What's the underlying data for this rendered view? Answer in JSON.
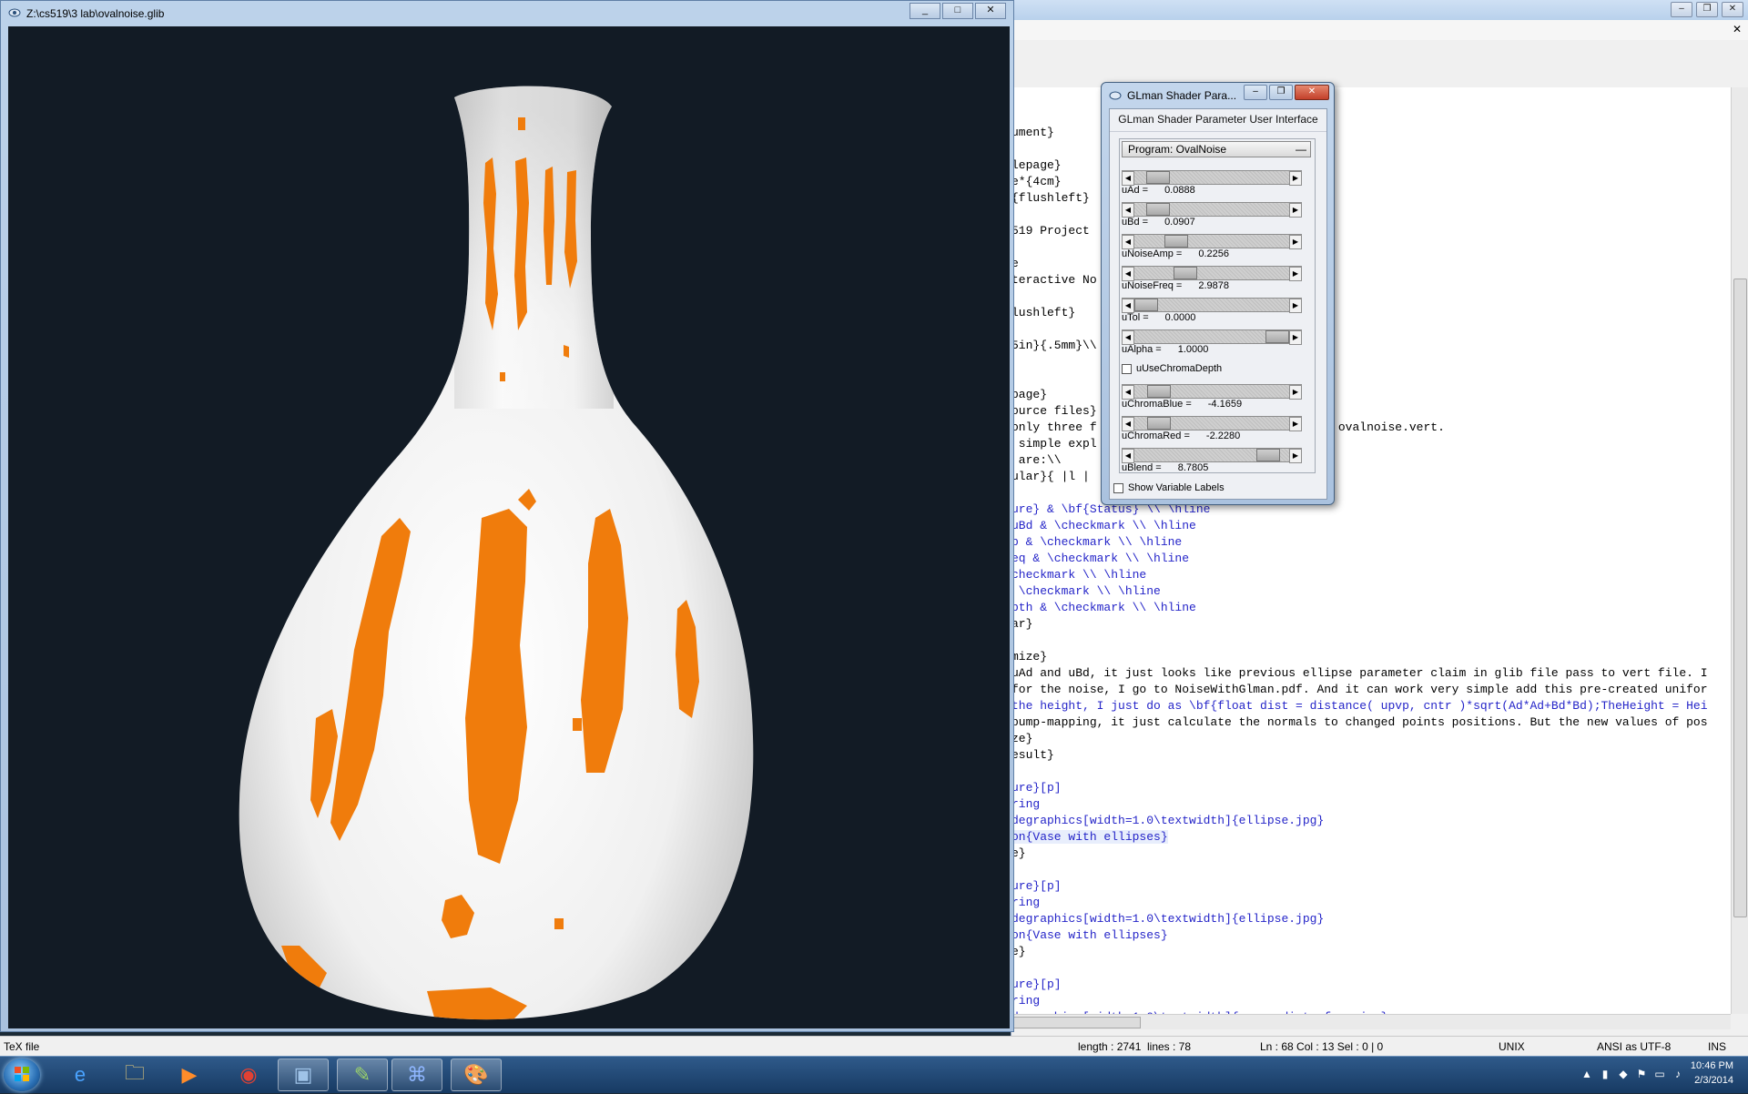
{
  "gl_window": {
    "title": "Z:\\cs519\\3 lab\\ovalnoise.glib",
    "btn_min": "_",
    "btn_max": "□",
    "btn_close": "✕"
  },
  "colors": {
    "vase_pattern": "#f07c0c",
    "canvas_bg": "#121b25",
    "vase_body": "#f4f4f4"
  },
  "shader_dialog": {
    "title": "GLman Shader Para...",
    "header": "GLman Shader Parameter User Interface",
    "program_label": "Program: OvalNoise",
    "program_toggle": "—",
    "params": [
      {
        "label": "uAd =",
        "value": "0.0888",
        "level": 0.09
      },
      {
        "label": "uBd =",
        "value": "0.0907",
        "level": 0.09
      },
      {
        "label": "uNoiseAmp =",
        "value": "0.2256",
        "level": 0.23
      },
      {
        "label": "uNoiseFreq =",
        "value": "2.9878",
        "level": 0.3
      },
      {
        "label": "uTol =",
        "value": "0.0000",
        "level": 0.0
      },
      {
        "label": "uAlpha =",
        "value": "1.0000",
        "level": 1.0
      },
      {
        "label": "uChromaBlue =",
        "value": "-4.1659",
        "level": 0.1
      },
      {
        "label": "uChromaRed =",
        "value": "-2.2280",
        "level": 0.1
      },
      {
        "label": "uBlend =",
        "value": "8.7805",
        "level": 0.93
      }
    ],
    "use_chroma_depth": "uUseChromaDepth",
    "show_labels": "Show Variable Labels"
  },
  "editor": {
    "lines": [
      "ument}",
      "",
      "lepage}",
      "e*{4cm}",
      "{flushleft}",
      "",
      "519 Project",
      "",
      "e",
      "teractive No",
      "",
      "lushleft}",
      "",
      "5in}{.5mm}\\\\",
      "",
      "",
      "page}",
      "ource files}",
      "only three f                          lib and ovalnoise.vert.",
      " simple expl",
      " are:\\\\",
      "ular}{ |l |",
      "",
      "ure} & \\bf{Status} \\\\ \\hline",
      "uBd & \\checkmark \\\\ \\hline",
      "p & \\checkmark \\\\ \\hline",
      "eq & \\checkmark \\\\ \\hline",
      "checkmark \\\\ \\hline",
      " \\checkmark \\\\ \\hline",
      "pth & \\checkmark \\\\ \\hline",
      "ar}",
      "",
      "mize}",
      "uAd and uBd, it just looks like previous ellipse parameter claim in glib file pass to vert file. I",
      "for the noise, I go to NoiseWithGlman.pdf. And it can work very simple add this pre-created unifor",
      "the height, I just do as \\bf{float dist = distance( upvp, cntr )*sqrt(Ad*Ad+Bd*Bd);TheHeight = Hei",
      "bump-mapping, it just calculate the normals to changed points positions. But the new values of pos",
      "ze}",
      "esult}",
      "",
      "ure}[p]",
      "ring",
      "degraphics[width=1.0\\textwidth]{ellipse.jpg}",
      "on{Vase with ellipses}",
      "e}",
      "",
      "ure}[p]",
      "ring",
      "degraphics[width=1.0\\textwidth]{ellipse.jpg}",
      "on{Vase with ellipses}",
      "e}",
      "",
      "ure}[p]",
      "ring",
      "degraphics[width=1.0\\textwidth]{vaseandinterface.jpg}"
    ]
  },
  "status_bar": {
    "file_type": "TeX file",
    "length": "length : 2741",
    "lines": "lines : 78",
    "position": "Ln : 68    Col : 13    Sel : 0 | 0",
    "eol": "UNIX",
    "encoding": "ANSI as UTF-8",
    "mode": "INS"
  },
  "taskbar": {
    "apps": [
      {
        "name": "internet-explorer",
        "glyph": "e"
      },
      {
        "name": "file-explorer",
        "glyph": "🗀"
      },
      {
        "name": "media-player",
        "glyph": "▶"
      },
      {
        "name": "chrome",
        "glyph": "◉"
      },
      {
        "name": "glman",
        "glyph": "▣"
      },
      {
        "name": "notepad-plus-plus",
        "glyph": "✎"
      },
      {
        "name": "network",
        "glyph": "⌘"
      },
      {
        "name": "paint",
        "glyph": "🎨"
      }
    ],
    "time": "10:46 PM",
    "date": "2/3/2014"
  }
}
